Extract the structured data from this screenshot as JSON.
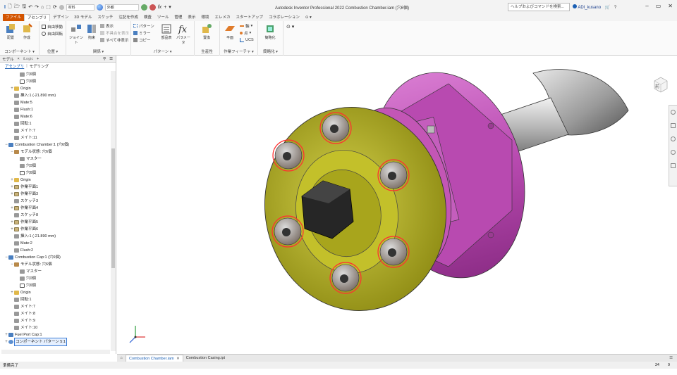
{
  "title_bar": {
    "app_title": "Autodesk Inventor Professional 2022   Combustion Chamber.iam (穴6個)",
    "material": "材料",
    "appearance": "外観",
    "help_search": "ヘルプおよびコマンドを検索...",
    "user": "ADI_kusano"
  },
  "tabs": [
    {
      "label": "ファイル",
      "kind": "file"
    },
    {
      "label": "アセンブリ",
      "kind": "active"
    },
    {
      "label": "デザイン",
      "kind": ""
    },
    {
      "label": "3D モデル",
      "kind": ""
    },
    {
      "label": "スケッチ",
      "kind": ""
    },
    {
      "label": "注記を作成",
      "kind": ""
    },
    {
      "label": "検査",
      "kind": ""
    },
    {
      "label": "ツール",
      "kind": ""
    },
    {
      "label": "管理",
      "kind": ""
    },
    {
      "label": "表示",
      "kind": ""
    },
    {
      "label": "環境",
      "kind": ""
    },
    {
      "label": "エレメカ",
      "kind": ""
    },
    {
      "label": "スタートアップ",
      "kind": ""
    },
    {
      "label": "コラボレーション",
      "kind": ""
    }
  ],
  "ribbon": {
    "component": {
      "place": "配置",
      "create": "作成",
      "free_move": "自由移動",
      "free_rotate": "自由回転",
      "label": "コンポーネント"
    },
    "position": {
      "label": "位置"
    },
    "relationships": {
      "joint": "ジョイント",
      "constrain": "拘束",
      "show": "表示",
      "show_sick": "不具合を表示",
      "hide_all": "すべて非表示",
      "label": "関係"
    },
    "pattern": {
      "pattern": "パターン",
      "mirror": "ミラー",
      "copy": "コピー",
      "bom": "部品表",
      "parameters": "パラメータ",
      "label": "パターン"
    },
    "productivity": {
      "replace": "置換",
      "label": "生産性"
    },
    "work_features": {
      "plane": "平面",
      "axis": "軸",
      "point": "点",
      "ucs": "UCS",
      "label": "作業フィーチャ"
    },
    "simplification": {
      "simplify": "簡略化",
      "label": "簡略化"
    }
  },
  "browser": {
    "tab_model": "モデル",
    "tab_close": "×",
    "tab_ilogic": "iLogic",
    "add": "+",
    "view_assembly": "アセンブリ",
    "view_modeling": "モデリング",
    "nodes": [
      {
        "indent": 2,
        "exp": "",
        "icon": "constraint",
        "text": "穴6個",
        "sel": false
      },
      {
        "indent": 2,
        "exp": "",
        "icon": "hole",
        "text": "穴6個",
        "sel": false
      },
      {
        "indent": 1,
        "exp": "+",
        "icon": "folder",
        "text": "Origin",
        "sel": false
      },
      {
        "indent": 1,
        "exp": "",
        "icon": "constraint",
        "text": "挿入:1 (-21.890 mm)",
        "sel": false
      },
      {
        "indent": 1,
        "exp": "",
        "icon": "constraint",
        "text": "Mate:5",
        "sel": false
      },
      {
        "indent": 1,
        "exp": "",
        "icon": "constraint",
        "text": "Flush:1",
        "sel": false
      },
      {
        "indent": 1,
        "exp": "",
        "icon": "constraint",
        "text": "Mate:6",
        "sel": false
      },
      {
        "indent": 1,
        "exp": "",
        "icon": "constraint",
        "text": "回転:1",
        "sel": false
      },
      {
        "indent": 1,
        "exp": "",
        "icon": "constraint",
        "text": "メイト:7",
        "sel": false
      },
      {
        "indent": 1,
        "exp": "",
        "icon": "constraint",
        "text": "メイト:11",
        "sel": false
      },
      {
        "indent": 0,
        "exp": "−",
        "icon": "part",
        "text": "Combustion Chamber:1 (穴6個)",
        "sel": false
      },
      {
        "indent": 1,
        "exp": "−",
        "icon": "rep",
        "text": "モデル状態: 穴6個",
        "sel": false
      },
      {
        "indent": 2,
        "exp": "",
        "icon": "constraint",
        "text": "マスター",
        "sel": false
      },
      {
        "indent": 2,
        "exp": "",
        "icon": "constraint",
        "text": "穴0個",
        "sel": false
      },
      {
        "indent": 2,
        "exp": "",
        "icon": "hole",
        "text": "穴6個",
        "sel": false
      },
      {
        "indent": 1,
        "exp": "+",
        "icon": "folder",
        "text": "Origin",
        "sel": false
      },
      {
        "indent": 1,
        "exp": "+",
        "icon": "plane",
        "text": "作業平面1",
        "sel": false
      },
      {
        "indent": 1,
        "exp": "+",
        "icon": "plane",
        "text": "作業平面3",
        "sel": false
      },
      {
        "indent": 1,
        "exp": "",
        "icon": "constraint",
        "text": "スケッチ3",
        "sel": false
      },
      {
        "indent": 1,
        "exp": "+",
        "icon": "plane",
        "text": "作業平面4",
        "sel": false
      },
      {
        "indent": 1,
        "exp": "",
        "icon": "constraint",
        "text": "スケッチ8",
        "sel": false
      },
      {
        "indent": 1,
        "exp": "+",
        "icon": "plane",
        "text": "作業平面5",
        "sel": false
      },
      {
        "indent": 1,
        "exp": "+",
        "icon": "plane",
        "text": "作業平面6",
        "sel": false
      },
      {
        "indent": 1,
        "exp": "",
        "icon": "constraint",
        "text": "挿入:1 (-21.890 mm)",
        "sel": false
      },
      {
        "indent": 1,
        "exp": "",
        "icon": "constraint",
        "text": "Mate:2",
        "sel": false
      },
      {
        "indent": 1,
        "exp": "",
        "icon": "constraint",
        "text": "Flush:2",
        "sel": false
      },
      {
        "indent": 0,
        "exp": "−",
        "icon": "part",
        "text": "Combustion Cap:1 (穴6個)",
        "sel": false
      },
      {
        "indent": 1,
        "exp": "−",
        "icon": "rep",
        "text": "モデル状態: 穴6個",
        "sel": false
      },
      {
        "indent": 2,
        "exp": "",
        "icon": "constraint",
        "text": "マスター",
        "sel": false
      },
      {
        "indent": 2,
        "exp": "",
        "icon": "constraint",
        "text": "穴0個",
        "sel": false
      },
      {
        "indent": 2,
        "exp": "",
        "icon": "hole",
        "text": "穴6個",
        "sel": false
      },
      {
        "indent": 1,
        "exp": "+",
        "icon": "folder",
        "text": "Origin",
        "sel": false
      },
      {
        "indent": 1,
        "exp": "",
        "icon": "constraint",
        "text": "回転:1",
        "sel": false
      },
      {
        "indent": 1,
        "exp": "",
        "icon": "constraint",
        "text": "メイト:7",
        "sel": false
      },
      {
        "indent": 1,
        "exp": "",
        "icon": "constraint",
        "text": "メイト:8",
        "sel": false
      },
      {
        "indent": 1,
        "exp": "",
        "icon": "constraint",
        "text": "メイト:9",
        "sel": false
      },
      {
        "indent": 1,
        "exp": "",
        "icon": "constraint",
        "text": "メイト:10",
        "sel": false
      },
      {
        "indent": 0,
        "exp": "+",
        "icon": "part",
        "text": "Fuel Port Cap:1",
        "sel": false
      },
      {
        "indent": 0,
        "exp": "+",
        "icon": "pattern",
        "text": "コンポーネント パターン 5:1",
        "sel": true
      }
    ]
  },
  "viewcube": {
    "face_label": "前"
  },
  "doc_tabs": [
    {
      "label": "Combustion Chamber.iam",
      "active": true,
      "closable": true
    },
    {
      "label": "Combustion Casing.ipt",
      "active": false,
      "closable": false
    }
  ],
  "status": {
    "text": "準備完了",
    "num1": "34",
    "num2": "9"
  },
  "colors": {
    "file_tab": "#d35400",
    "chamber": "#c356b5",
    "cap": "#b7b52a",
    "bolt": "#b0a49a",
    "bolt_ring": "#ff3030",
    "shaft": "#c8c8c8"
  }
}
